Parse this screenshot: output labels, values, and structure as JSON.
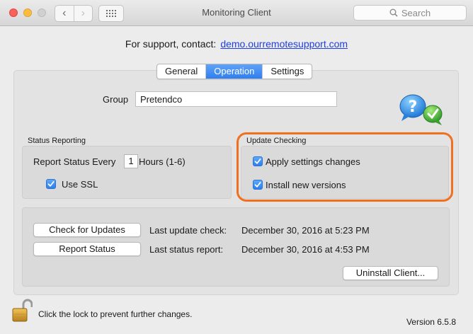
{
  "window": {
    "title": "Monitoring Client",
    "search_placeholder": "Search",
    "colors": {
      "close": "#fc605c",
      "minimize": "#fdbc40",
      "zoom": "#d0d0d0"
    }
  },
  "support": {
    "label": "For support, contact:",
    "link": "demo.ourremotesupport.com"
  },
  "tabs": [
    {
      "label": "General",
      "active": false
    },
    {
      "label": "Operation",
      "active": true
    },
    {
      "label": "Settings",
      "active": false
    }
  ],
  "group": {
    "label": "Group",
    "value": "Pretendco"
  },
  "status_reporting": {
    "title": "Status Reporting",
    "report_every_label": "Report Status Every",
    "hours_value": "1",
    "hours_label": "Hours (1-6)",
    "use_ssl_label": "Use SSL",
    "use_ssl_checked": true
  },
  "update_checking": {
    "title": "Update Checking",
    "apply_settings_label": "Apply settings changes",
    "apply_settings_checked": true,
    "install_versions_label": "Install new versions",
    "install_versions_checked": true,
    "highlight_color": "#f07020"
  },
  "actions": {
    "check_updates_button": "Check for Updates",
    "last_update_label": "Last update check:",
    "last_update_value": "December 30, 2016 at 5:23 PM",
    "report_status_button": "Report Status",
    "last_status_label": "Last status report:",
    "last_status_value": "December 30, 2016 at 4:53 PM",
    "uninstall_button": "Uninstall Client..."
  },
  "footer": {
    "lock_text": "Click the lock to prevent further changes.",
    "version": "Version 6.5.8"
  },
  "accent_color": "#2f7ef0"
}
